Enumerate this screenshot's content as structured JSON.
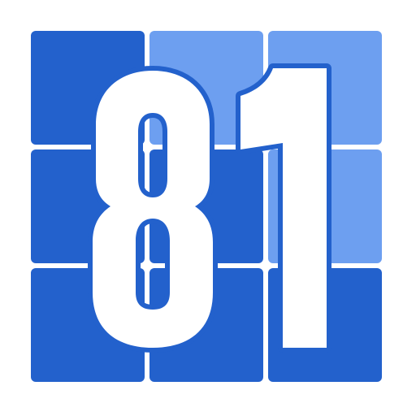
{
  "icon": {
    "digits": [
      "8",
      "1"
    ],
    "grid_rows": 3,
    "grid_cols": 3,
    "tile_shades": [
      [
        "dark",
        "light",
        "light"
      ],
      [
        "dark",
        "dark",
        "light"
      ],
      [
        "dark",
        "dark",
        "dark"
      ]
    ]
  },
  "colors": {
    "background": "#ffffff",
    "tile_dark": "#2361cc",
    "tile_light": "#6d9ff0",
    "digit_fill": "#ffffff",
    "digit_outline": "#2361cc"
  }
}
